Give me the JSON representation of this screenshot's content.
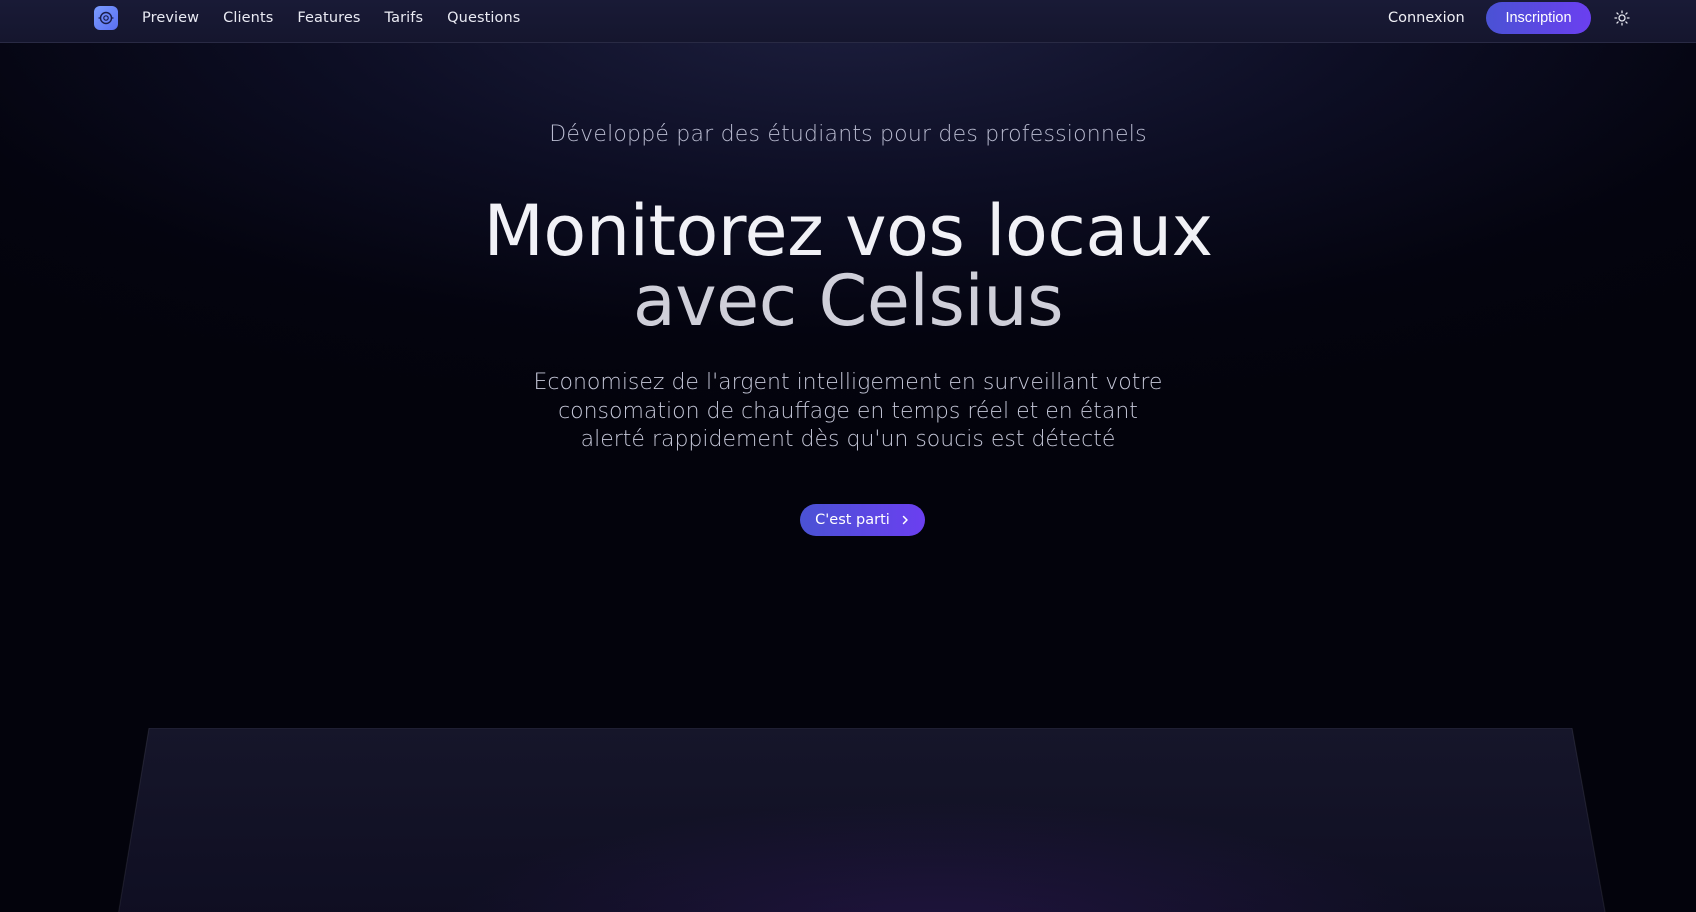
{
  "nav": {
    "logo_icon": "celsius-logo-icon",
    "links": [
      "Preview",
      "Clients",
      "Features",
      "Tarifs",
      "Questions"
    ],
    "login_label": "Connexion",
    "signup_label": "Inscription",
    "theme_icon": "sun-icon"
  },
  "hero": {
    "tagline": "Développé par des étudiants pour des professionnels",
    "headline_line1": "Monitorez vos locaux",
    "headline_line2": "avec Celsius",
    "subtitle": "Economisez de l'argent intelligement en surveillant votre consomation de chauffage en temps réel et en étant alerté rappidement dès qu'un soucis est détecté",
    "cta_label": "C'est parti",
    "cta_icon": "chevron-right-icon"
  },
  "colors": {
    "accent_start": "#4a52d4",
    "accent_end": "#6b3ff0",
    "background": "#04040f"
  }
}
